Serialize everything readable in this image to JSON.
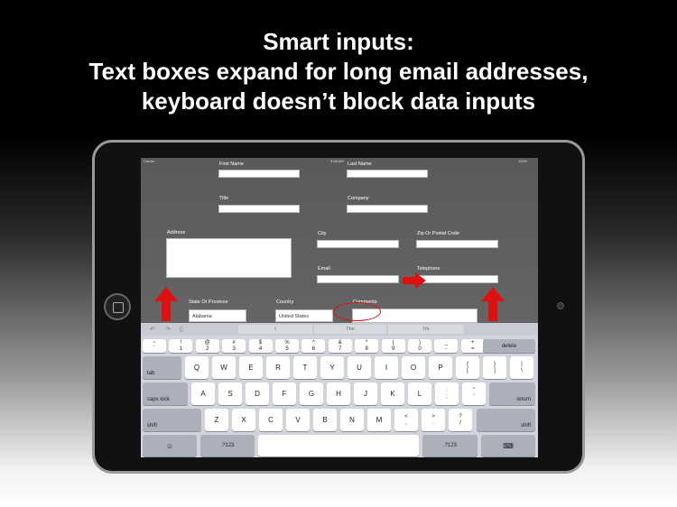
{
  "headline": {
    "line1": "Smart inputs:",
    "line2": "Text boxes expand for long email addresses,",
    "line3": "keyboard doesn’t block data inputs"
  },
  "status_bar": {
    "carrier": "Carrier",
    "time": "9:08 AM",
    "battery": "100%"
  },
  "form": {
    "first_name": {
      "label": "First Name",
      "value": ""
    },
    "last_name": {
      "label": "Last Name",
      "value": ""
    },
    "title": {
      "label": "Title",
      "value": ""
    },
    "company": {
      "label": "Company",
      "value": ""
    },
    "address": {
      "label": "Address",
      "value": ""
    },
    "city": {
      "label": "City",
      "value": ""
    },
    "zip": {
      "label": "Zip Or Postal Code",
      "value": ""
    },
    "email": {
      "label": "Email",
      "value": ""
    },
    "telephone": {
      "label": "Telephone",
      "value": ""
    },
    "state": {
      "label": "State Or Province",
      "value": "Alabama"
    },
    "country": {
      "label": "Country",
      "value": "United States"
    },
    "comments": {
      "label": "Comments",
      "value": ""
    }
  },
  "keyboard": {
    "suggestions": [
      "I",
      "The",
      "I'm"
    ],
    "row1": [
      [
        "~",
        "`"
      ],
      [
        "!",
        "1"
      ],
      [
        "@",
        "2"
      ],
      [
        "#",
        "3"
      ],
      [
        "$",
        "4"
      ],
      [
        "%",
        "5"
      ],
      [
        "^",
        "6"
      ],
      [
        "&",
        "7"
      ],
      [
        "*",
        "8"
      ],
      [
        "(",
        "9"
      ],
      [
        ")",
        "0"
      ],
      [
        "_",
        "-"
      ],
      [
        "+",
        "="
      ]
    ],
    "delete_label": "delete",
    "tab_label": "tab",
    "row2": [
      "Q",
      "W",
      "E",
      "R",
      "T",
      "Y",
      "U",
      "I",
      "O",
      "P"
    ],
    "row2_sym": [
      [
        "{",
        "["
      ],
      [
        "}",
        "]"
      ],
      [
        "|",
        "\\"
      ]
    ],
    "caps_label": "caps lock",
    "row3": [
      "A",
      "S",
      "D",
      "F",
      "G",
      "H",
      "J",
      "K",
      "L"
    ],
    "row3_sym": [
      [
        ":",
        ";"
      ],
      [
        "\"",
        "'"
      ]
    ],
    "return_label": "return",
    "shift_label": "shift",
    "row4": [
      "Z",
      "X",
      "C",
      "V",
      "B",
      "N",
      "M"
    ],
    "row4_sym": [
      [
        "<",
        ","
      ],
      [
        ">",
        "."
      ],
      [
        "?",
        "/"
      ]
    ],
    "numbers_label": ".?123"
  },
  "colors": {
    "accent_red": "#e01010"
  }
}
